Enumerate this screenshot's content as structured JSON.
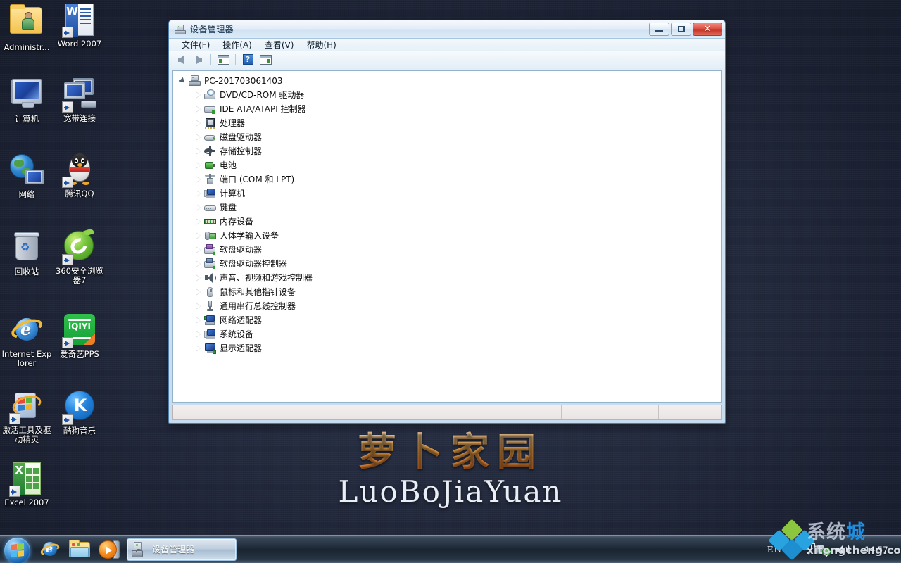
{
  "desktop": {
    "wallpaper_brand_cn": "萝卜家园",
    "wallpaper_brand_en": "LuoBoJiaYuan",
    "icons": [
      {
        "label": "Administr...",
        "icon": "user-folder-icon",
        "shortcut": false
      },
      {
        "label": "Word 2007",
        "icon": "word-document-icon",
        "shortcut": true
      },
      {
        "label": "计算机",
        "icon": "computer-monitor-icon",
        "shortcut": false
      },
      {
        "label": "宽带连接",
        "icon": "broadband-connection-icon",
        "shortcut": true
      },
      {
        "label": "网络",
        "icon": "network-globe-icon",
        "shortcut": false
      },
      {
        "label": "腾讯QQ",
        "icon": "qq-penguin-icon",
        "shortcut": true
      },
      {
        "label": "回收站",
        "icon": "recycle-bin-icon",
        "shortcut": false
      },
      {
        "label": "360安全浏览器7",
        "icon": "360-browser-icon",
        "shortcut": true
      },
      {
        "label": "Internet Explorer",
        "icon": "internet-explorer-icon",
        "shortcut": false
      },
      {
        "label": "爱奇艺PPS",
        "icon": "iqiyi-pps-icon",
        "shortcut": true
      },
      {
        "label": "激活工具及驱动精灵",
        "icon": "activation-tool-icon",
        "shortcut": true
      },
      {
        "label": "酷狗音乐",
        "icon": "kugou-music-icon",
        "shortcut": true
      },
      {
        "label": "Excel 2007",
        "icon": "excel-document-icon",
        "shortcut": true
      }
    ]
  },
  "window": {
    "title": "设备管理器",
    "title_icon": "device-manager-icon",
    "buttons": {
      "minimize": "最小化",
      "maximize": "最大化",
      "close": "关闭"
    },
    "menu": [
      {
        "label": "文件(F)",
        "name": "menu-file"
      },
      {
        "label": "操作(A)",
        "name": "menu-action"
      },
      {
        "label": "查看(V)",
        "name": "menu-view"
      },
      {
        "label": "帮助(H)",
        "name": "menu-help"
      }
    ],
    "toolbar": [
      {
        "name": "back-arrow-icon",
        "title": "后退"
      },
      {
        "name": "forward-arrow-icon",
        "title": "前进"
      },
      {
        "name": "properties-panel-icon",
        "title": "属性"
      },
      {
        "name": "help-question-icon",
        "title": "帮助"
      },
      {
        "name": "show-hidden-devices-icon",
        "title": "显示隐藏的设备"
      }
    ],
    "statusbar": {
      "pane1": "",
      "pane2": "",
      "pane3": ""
    }
  },
  "tree": {
    "root": {
      "label": "PC-201703061403",
      "icon": "computer-root-icon",
      "expanded": true
    },
    "nodes": [
      {
        "label": "DVD/CD-ROM 驱动器",
        "icon": "dvd-drive-icon"
      },
      {
        "label": "IDE ATA/ATAPI 控制器",
        "icon": "ide-controller-icon"
      },
      {
        "label": "处理器",
        "icon": "processor-icon"
      },
      {
        "label": "磁盘驱动器",
        "icon": "disk-drive-icon"
      },
      {
        "label": "存储控制器",
        "icon": "storage-controller-icon"
      },
      {
        "label": "电池",
        "icon": "battery-icon"
      },
      {
        "label": "端口 (COM 和 LPT)",
        "icon": "ports-icon"
      },
      {
        "label": "计算机",
        "icon": "computer-icon"
      },
      {
        "label": "键盘",
        "icon": "keyboard-icon"
      },
      {
        "label": "内存设备",
        "icon": "memory-device-icon"
      },
      {
        "label": "人体学输入设备",
        "icon": "hid-device-icon"
      },
      {
        "label": "软盘驱动器",
        "icon": "floppy-drive-icon"
      },
      {
        "label": "软盘驱动器控制器",
        "icon": "floppy-controller-icon"
      },
      {
        "label": "声音、视频和游戏控制器",
        "icon": "sound-video-game-icon"
      },
      {
        "label": "鼠标和其他指针设备",
        "icon": "mouse-pointer-icon"
      },
      {
        "label": "通用串行总线控制器",
        "icon": "usb-controller-icon"
      },
      {
        "label": "网络适配器",
        "icon": "network-adapter-icon"
      },
      {
        "label": "系统设备",
        "icon": "system-device-icon"
      },
      {
        "label": "显示适配器",
        "icon": "display-adapter-icon"
      }
    ]
  },
  "taskbar": {
    "start_button": "开始",
    "quick_launch": [
      {
        "name": "internet-explorer-icon",
        "title": "Internet Explorer"
      },
      {
        "name": "windows-explorer-icon",
        "title": "Windows 资源管理器"
      },
      {
        "name": "media-player-icon",
        "title": "Windows Media Player"
      }
    ],
    "task_buttons": [
      {
        "label": "设备管理器",
        "icon": "device-manager-icon",
        "active": true
      }
    ],
    "tray": {
      "language": "EN",
      "help_icon": "?",
      "icons": [
        {
          "name": "show-hidden-icons-chevron"
        },
        {
          "name": "network-status-icon"
        },
        {
          "name": "volume-speaker-icon"
        }
      ],
      "clock_time": "14:57"
    }
  },
  "watermark": {
    "brand_cn_part1": "系统",
    "brand_cn_part2": "城",
    "brand_url": "xitongcheng.com",
    "logo": "diamond-cluster-logo"
  },
  "colors": {
    "desktop_bg": "#232a3d",
    "window_border": "#4f7ca8",
    "titlebar": "#dcebf7",
    "close_button": "#c23124",
    "accent_blue": "#1e8fe0",
    "brand_orange": "#f6a94c"
  }
}
